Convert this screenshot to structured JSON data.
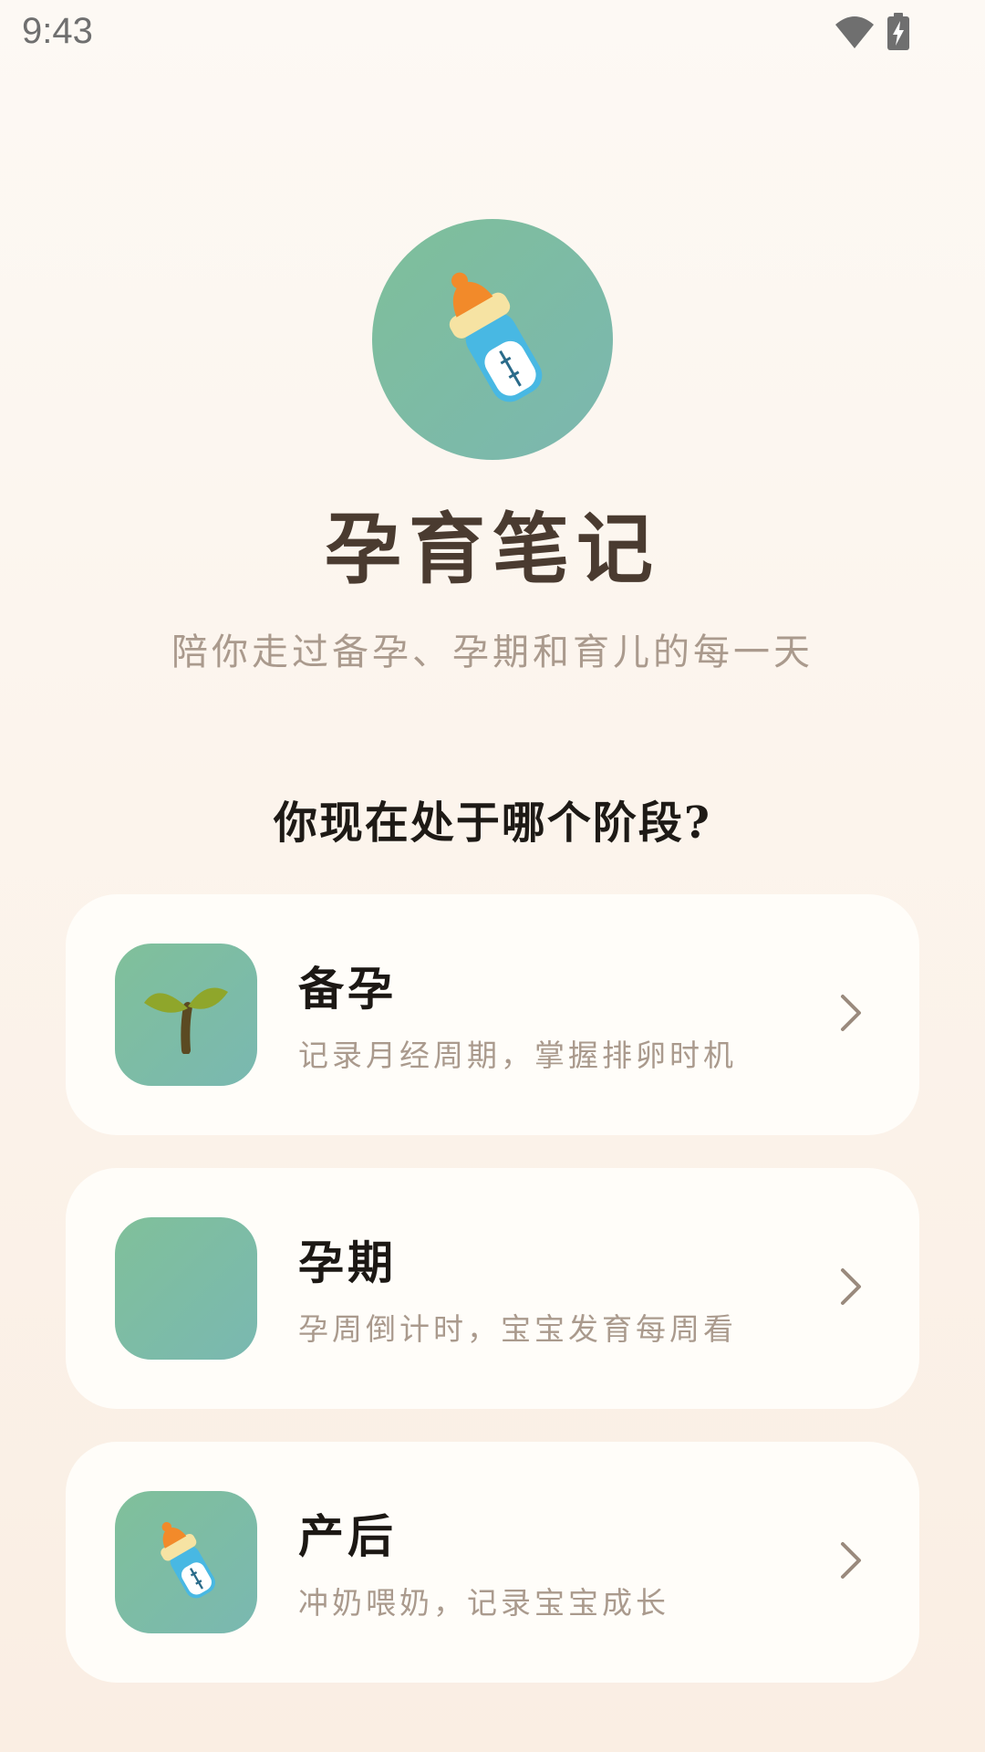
{
  "status_bar": {
    "time": "9:43",
    "icons": [
      "wifi-icon",
      "battery-charging-icon"
    ]
  },
  "hero": {
    "icon": "baby-bottle-icon",
    "title": "孕育笔记",
    "subtitle": "陪你走过备孕、孕期和育儿的每一天"
  },
  "question": "你现在处于哪个阶段?",
  "stages": [
    {
      "title": "备孕",
      "description": "记录月经周期，掌握排卵时机",
      "icon": "seedling-icon"
    },
    {
      "title": "孕期",
      "description": "孕周倒计时，宝宝发育每周看",
      "icon": "blank-icon"
    },
    {
      "title": "产后",
      "description": "冲奶喂奶，记录宝宝成长",
      "icon": "baby-bottle-icon"
    }
  ],
  "colors": {
    "accent_green": "#7fbf9a",
    "title_brown": "#4a3b30",
    "muted_text": "#aa9a8d",
    "card_background": "#fffdf9"
  }
}
